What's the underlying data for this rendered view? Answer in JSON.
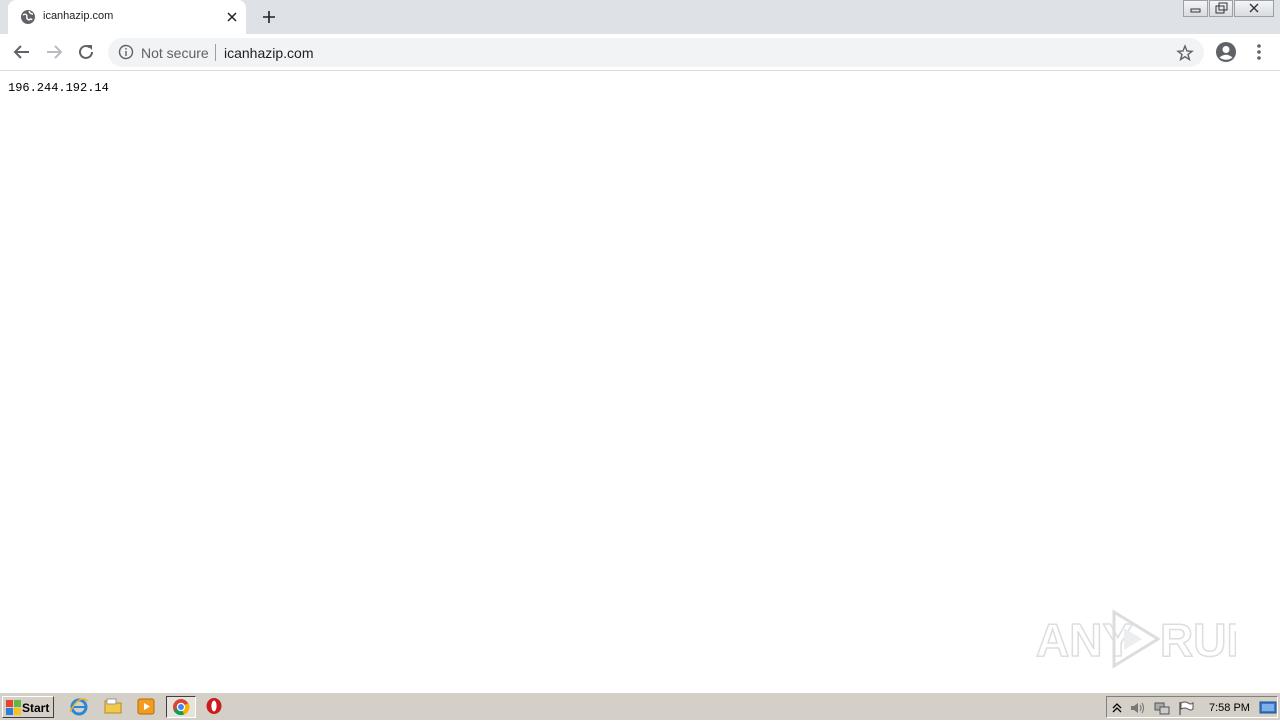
{
  "browser": {
    "tab": {
      "title": "icanhazip.com"
    },
    "omnibox": {
      "security_label": "Not secure",
      "url": "icanhazip.com"
    }
  },
  "page": {
    "body_text": "196.244.192.14"
  },
  "watermark": {
    "text": "ANY RUN"
  },
  "taskbar": {
    "start_label": "Start",
    "clock": "7:58 PM"
  },
  "colors": {
    "tab_strip": "#dee1e6",
    "omnibox_bg": "#f1f3f4",
    "taskbar": "#d4d0c8",
    "icon_gray": "#5f6368"
  }
}
